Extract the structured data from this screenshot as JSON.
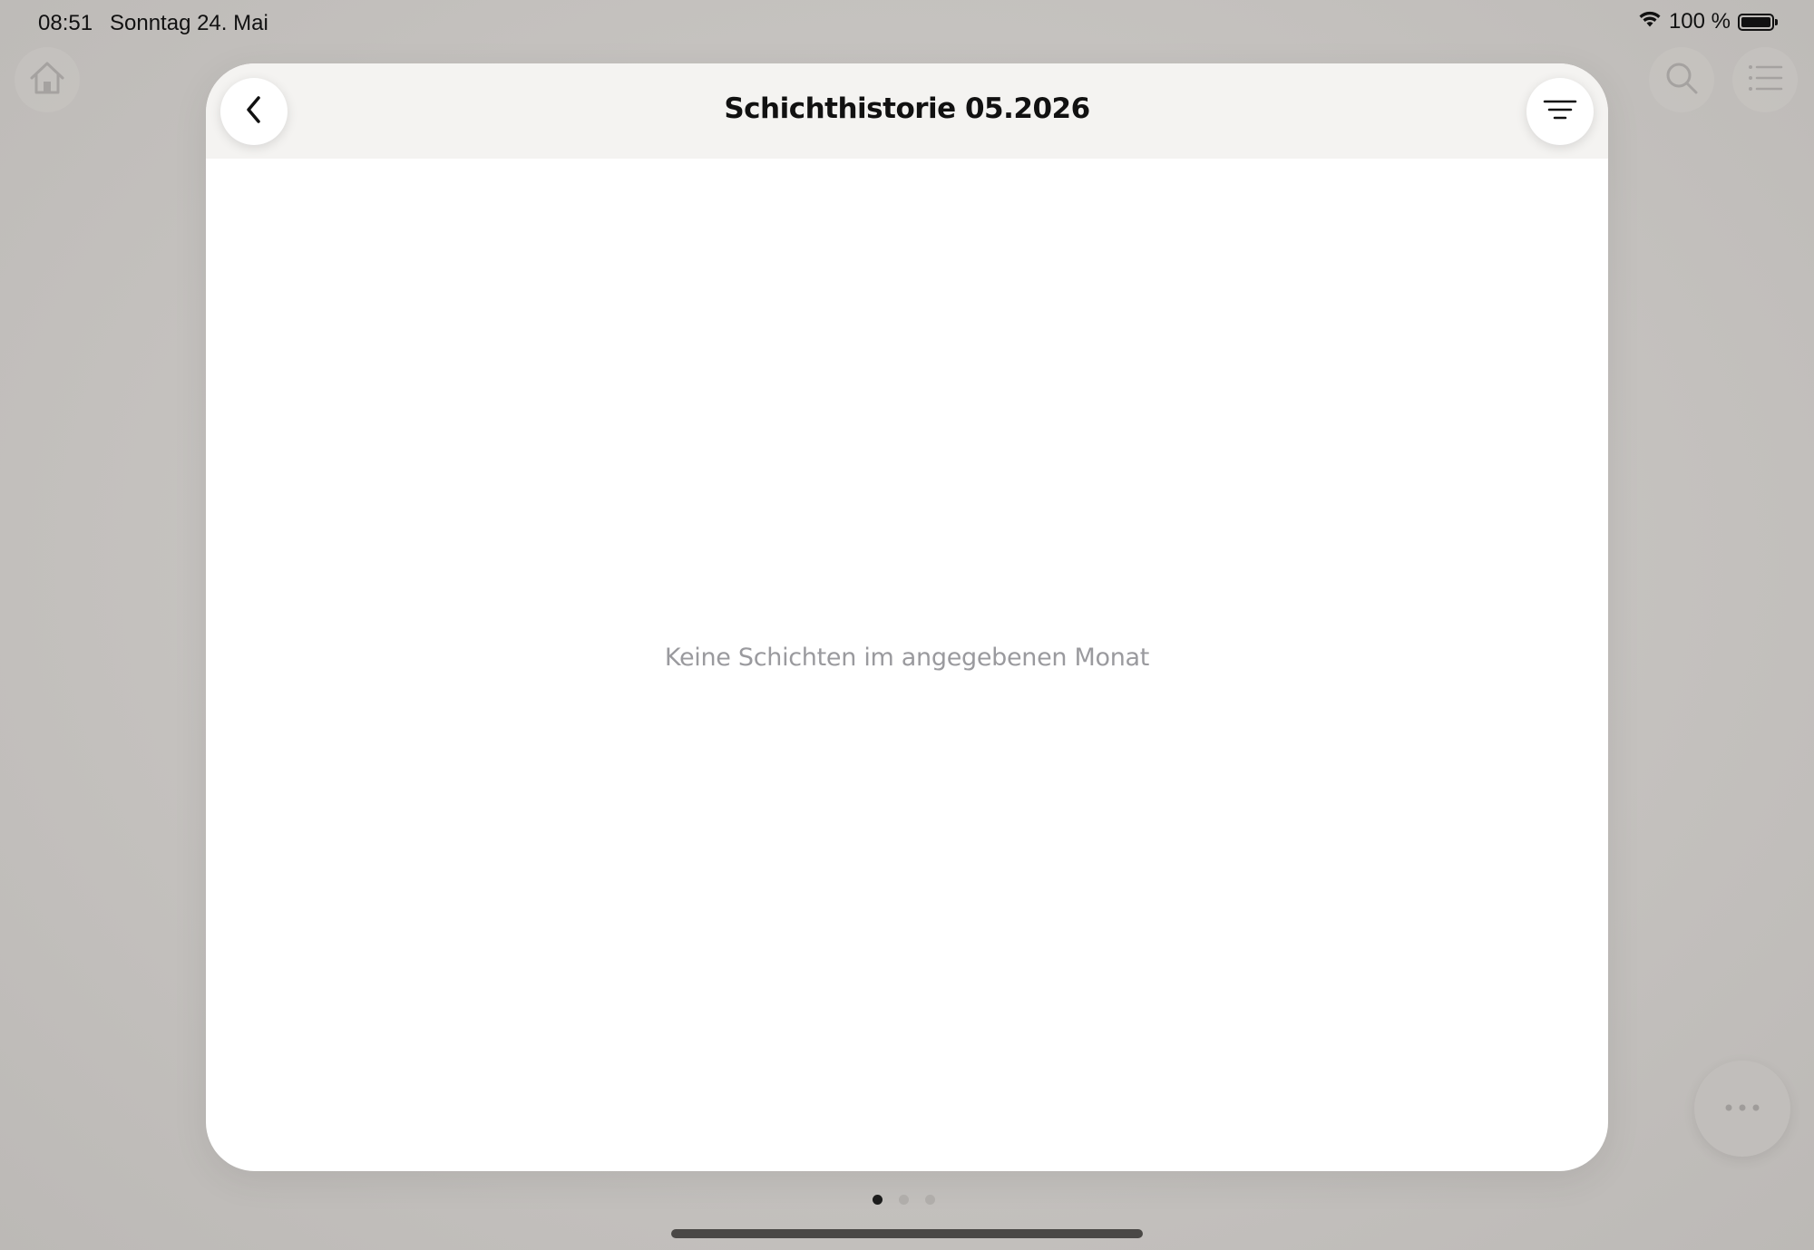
{
  "status_bar": {
    "time": "08:51",
    "date": "Sonntag 24. Mai",
    "battery_percent": "100 %",
    "icons": [
      "wifi-icon",
      "battery-icon"
    ]
  },
  "background_controls": {
    "icons": [
      "home-icon",
      "search-icon",
      "list-icon",
      "more-icon"
    ]
  },
  "modal": {
    "title": "Schichthistorie 05.2026",
    "empty_message": "Keine Schichten im angegebenen Monat",
    "back_icon": "chevron-left-icon",
    "filter_icon": "filter-icon"
  },
  "pagination": {
    "page_count": 3,
    "active_page": 1
  },
  "colors": {
    "title": "#111111",
    "empty_message": "#9a9a9e",
    "header_background": "#f4f3f1",
    "backdrop": "#c6c3c0",
    "active_dot": "#1c1c1c"
  }
}
